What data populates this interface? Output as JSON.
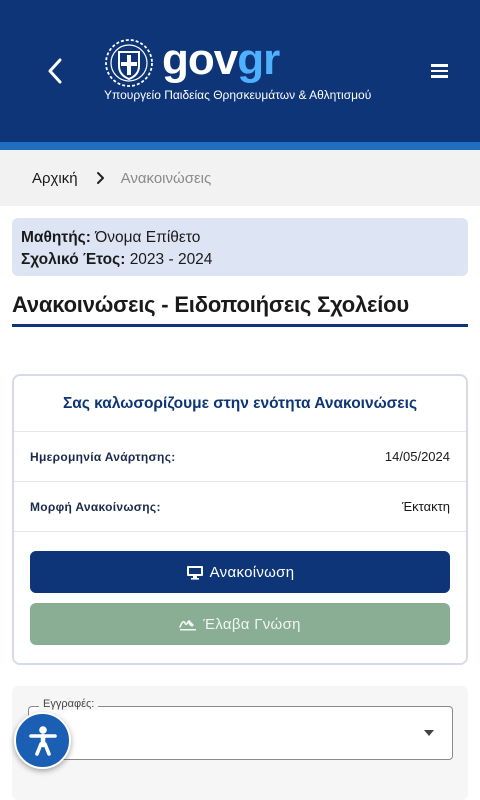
{
  "header": {
    "logo_gov": "gov",
    "logo_gr": "gr",
    "ministry": "Υπουργείο Παιδείας Θρησκευμάτων & Αθλητισμού",
    "back_icon": "chevron-left-icon",
    "menu_icon": "hamburger-menu-icon"
  },
  "breadcrumb": {
    "home": "Αρχική",
    "current": "Ανακοινώσεις"
  },
  "student": {
    "name_label": "Μαθητής:",
    "name_value": "Όνομα Επίθετο",
    "year_label": "Σχολικό Έτος:",
    "year_value": "2023 - 2024"
  },
  "page_title": "Ανακοινώσεις - Ειδοποιήσεις Σχολείου",
  "card": {
    "heading": "Σας καλωσορίζουμε στην ενότητα Ανακοινώσεις",
    "date_label": "Ημερομηνία Ανάρτησης:",
    "date_value": "14/05/2024",
    "type_label": "Μορφή Ανακοίνωσης:",
    "type_value": "Έκτακτη",
    "primary_button": "Ανακοίνωση",
    "secondary_button": "Έλαβα Γνώση"
  },
  "registrations": {
    "label": "Εγγραφές:"
  },
  "colors": {
    "brand_navy": "#0d3577",
    "accent_blue": "#1e6fc0",
    "info_bg": "#dde5f4",
    "ack_green": "#8aae94",
    "a11y_blue": "#1a5fb4"
  }
}
